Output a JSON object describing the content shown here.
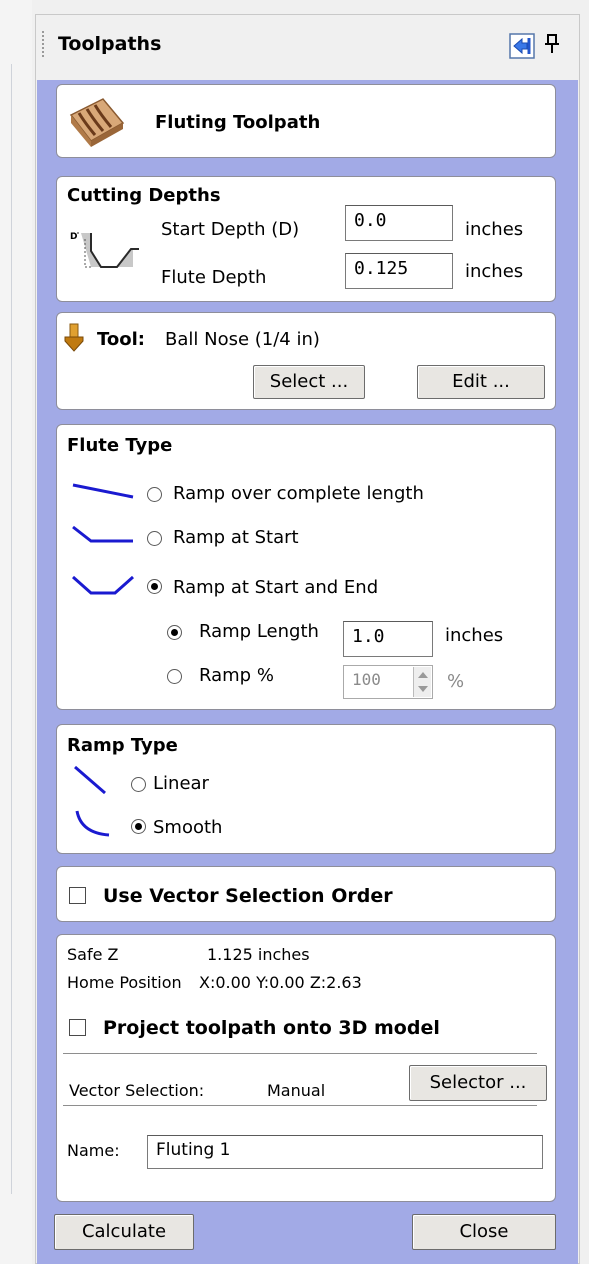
{
  "panel": {
    "title": "Toolpaths"
  },
  "header": {
    "title": "Fluting Toolpath"
  },
  "cutting_depths": {
    "heading": "Cutting Depths",
    "start_label": "Start Depth (D)",
    "start_value": "0.0",
    "start_unit": "inches",
    "flute_label": "Flute Depth",
    "flute_value": "0.125",
    "flute_unit": "inches",
    "diagram_letter": "D"
  },
  "tool": {
    "label": "Tool:",
    "name": "Ball Nose (1/4 in)",
    "select_button": "Select ...",
    "edit_button": "Edit ..."
  },
  "flute_type": {
    "heading": "Flute Type",
    "options": [
      "Ramp over complete length",
      "Ramp at Start",
      "Ramp at Start and End"
    ],
    "selected": 2,
    "ramp_length_label": "Ramp Length",
    "ramp_length_value": "1.0",
    "ramp_length_unit": "inches",
    "ramp_pct_label": "Ramp %",
    "ramp_pct_value": "100",
    "ramp_pct_unit": "%",
    "ramp_mode_selected": "length"
  },
  "ramp_type": {
    "heading": "Ramp Type",
    "options": [
      "Linear",
      "Smooth"
    ],
    "selected": 1
  },
  "vector_order": {
    "label": "Use Vector Selection Order",
    "checked": false
  },
  "settings": {
    "safe_z_label": "Safe Z",
    "safe_z_value": "1.125 inches",
    "home_label": "Home Position",
    "home_value": "X:0.00 Y:0.00 Z:2.63",
    "project_label": "Project toolpath onto 3D model",
    "project_checked": false,
    "vector_sel_label": "Vector Selection:",
    "vector_sel_value": "Manual",
    "selector_button": "Selector ...",
    "name_label": "Name:",
    "name_value": "Fluting 1"
  },
  "footer": {
    "calculate": "Calculate",
    "close": "Close"
  },
  "colors": {
    "pane": "#a2aae6",
    "line_icon": "#1a1ad0",
    "tool_icon": "#c07a10"
  }
}
